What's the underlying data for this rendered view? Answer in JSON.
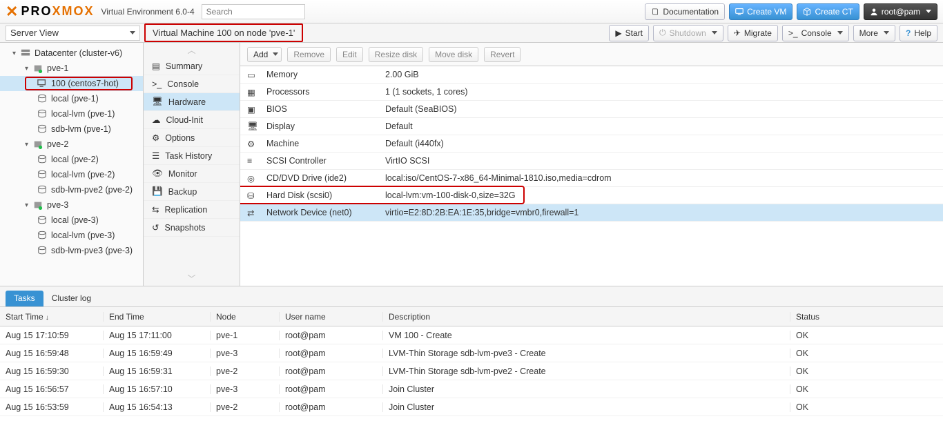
{
  "brand": {
    "ve_label": "Virtual Environment 6.0-4"
  },
  "search": {
    "placeholder": "Search"
  },
  "top_buttons": {
    "doc": "Documentation",
    "create_vm": "Create VM",
    "create_ct": "Create CT",
    "user": "root@pam"
  },
  "server_view": "Server View",
  "breadcrumb": "Virtual Machine 100 on node 'pve-1'",
  "vm_actions": {
    "start": "Start",
    "shutdown": "Shutdown",
    "migrate": "Migrate",
    "console": "Console",
    "more": "More",
    "help": "Help"
  },
  "tree": {
    "datacenter": "Datacenter (cluster-v6)",
    "pve1": "pve-1",
    "vm100": "100 (centos7-hot)",
    "local1": "local (pve-1)",
    "locallvm1": "local-lvm (pve-1)",
    "sdb1": "sdb-lvm (pve-1)",
    "pve2": "pve-2",
    "local2": "local (pve-2)",
    "locallvm2": "local-lvm (pve-2)",
    "sdb2": "sdb-lvm-pve2 (pve-2)",
    "pve3": "pve-3",
    "local3": "local (pve-3)",
    "locallvm3": "local-lvm (pve-3)",
    "sdb3": "sdb-lvm-pve3 (pve-3)"
  },
  "sidemenu": {
    "summary": "Summary",
    "console": "Console",
    "hardware": "Hardware",
    "cloudinit": "Cloud-Init",
    "options": "Options",
    "taskhist": "Task History",
    "monitor": "Monitor",
    "backup": "Backup",
    "replication": "Replication",
    "snapshots": "Snapshots"
  },
  "toolbar": {
    "add": "Add",
    "remove": "Remove",
    "edit": "Edit",
    "resize": "Resize disk",
    "move": "Move disk",
    "revert": "Revert"
  },
  "hardware": [
    {
      "k": "Memory",
      "v": "2.00 GiB",
      "icon": "mem"
    },
    {
      "k": "Processors",
      "v": "1 (1 sockets, 1 cores)",
      "icon": "cpu"
    },
    {
      "k": "BIOS",
      "v": "Default (SeaBIOS)",
      "icon": "bios"
    },
    {
      "k": "Display",
      "v": "Default",
      "icon": "display"
    },
    {
      "k": "Machine",
      "v": "Default (i440fx)",
      "icon": "gear"
    },
    {
      "k": "SCSI Controller",
      "v": "VirtIO SCSI",
      "icon": "scsi"
    },
    {
      "k": "CD/DVD Drive (ide2)",
      "v": "local:iso/CentOS-7-x86_64-Minimal-1810.iso,media=cdrom",
      "icon": "cd"
    },
    {
      "k": "Hard Disk (scsi0)",
      "v": "local-lvm:vm-100-disk-0,size=32G",
      "icon": "hd"
    },
    {
      "k": "Network Device (net0)",
      "v": "virtio=E2:8D:2B:EA:1E:35,bridge=vmbr0,firewall=1",
      "icon": "net"
    }
  ],
  "bottom_tabs": {
    "tasks": "Tasks",
    "cluster": "Cluster log"
  },
  "grid_headers": {
    "start": "Start Time",
    "end": "End Time",
    "node": "Node",
    "user": "User name",
    "desc": "Description",
    "status": "Status"
  },
  "tasks": [
    {
      "st": "Aug 15 17:10:59",
      "et": "Aug 15 17:11:00",
      "nd": "pve-1",
      "un": "root@pam",
      "de": "VM 100 - Create",
      "ok": "OK"
    },
    {
      "st": "Aug 15 16:59:48",
      "et": "Aug 15 16:59:49",
      "nd": "pve-3",
      "un": "root@pam",
      "de": "LVM-Thin Storage sdb-lvm-pve3 - Create",
      "ok": "OK"
    },
    {
      "st": "Aug 15 16:59:30",
      "et": "Aug 15 16:59:31",
      "nd": "pve-2",
      "un": "root@pam",
      "de": "LVM-Thin Storage sdb-lvm-pve2 - Create",
      "ok": "OK"
    },
    {
      "st": "Aug 15 16:56:57",
      "et": "Aug 15 16:57:10",
      "nd": "pve-3",
      "un": "root@pam",
      "de": "Join Cluster",
      "ok": "OK"
    },
    {
      "st": "Aug 15 16:53:59",
      "et": "Aug 15 16:54:13",
      "nd": "pve-2",
      "un": "root@pam",
      "de": "Join Cluster",
      "ok": "OK"
    }
  ]
}
